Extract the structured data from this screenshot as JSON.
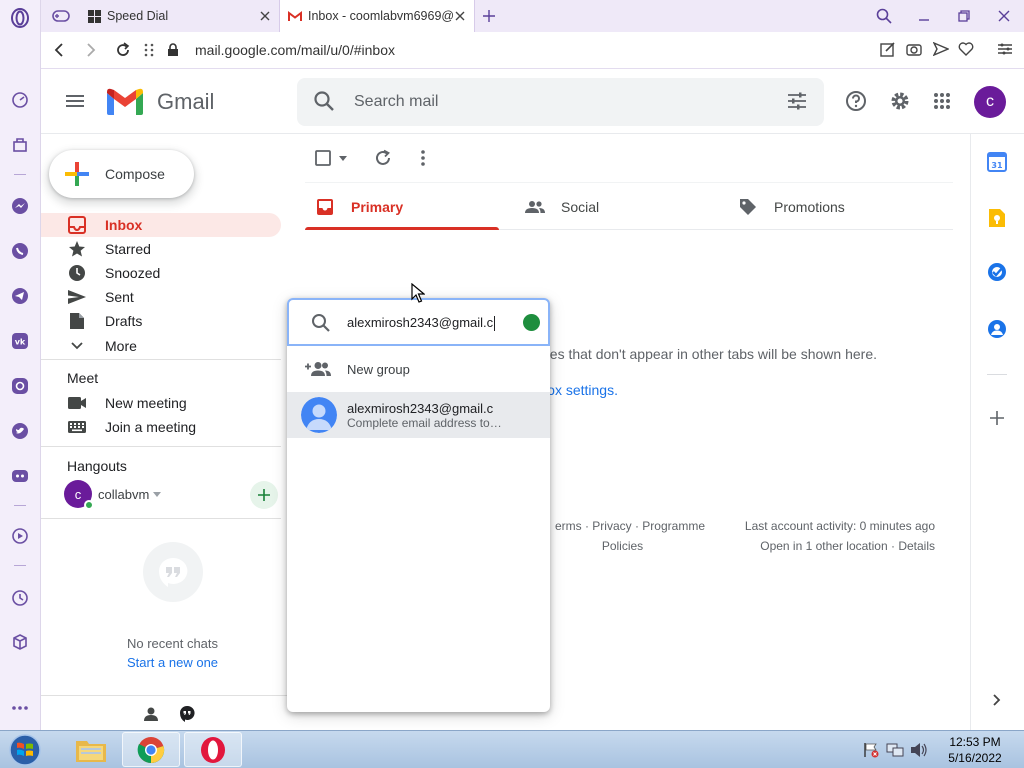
{
  "browser": {
    "tabs": [
      {
        "title": "Speed Dial",
        "active": false
      },
      {
        "title": "Inbox - coomlabvm6969@",
        "active": true
      }
    ],
    "url": "mail.google.com/mail/u/0/#inbox"
  },
  "gmail": {
    "wordmark": "Gmail",
    "search_placeholder": "Search mail",
    "avatar_letter": "c",
    "compose_label": "Compose",
    "nav": [
      {
        "label": "Inbox",
        "icon": "inbox-icon",
        "active": true
      },
      {
        "label": "Starred",
        "icon": "star-icon"
      },
      {
        "label": "Snoozed",
        "icon": "clock-icon"
      },
      {
        "label": "Sent",
        "icon": "send-icon"
      },
      {
        "label": "Drafts",
        "icon": "draft-icon"
      },
      {
        "label": "More",
        "icon": "chevron-down-icon"
      }
    ],
    "meet": {
      "title": "Meet",
      "items": [
        {
          "label": "New meeting",
          "icon": "video-icon"
        },
        {
          "label": "Join a meeting",
          "icon": "keyboard-icon"
        }
      ]
    },
    "hangouts": {
      "title": "Hangouts",
      "user_initial": "c",
      "user_name": "collabvm",
      "no_recent": "No recent chats",
      "start_new": "Start a new one"
    },
    "tabs": [
      {
        "label": "Primary",
        "icon": "inbox-icon",
        "active": true
      },
      {
        "label": "Social",
        "icon": "people-icon"
      },
      {
        "label": "Promotions",
        "icon": "tag-icon"
      }
    ],
    "empty_message": "es that don't appear in other tabs will be shown here.",
    "inbox_settings_link": "ox settings.",
    "footer": {
      "terms_line1": "erms · Privacy · Programme",
      "terms_line2": "Policies",
      "activity": "Last account activity: 0 minutes ago",
      "other_location": "Open in 1 other location · Details"
    }
  },
  "popup": {
    "input_value": "alexmirosh2343@gmail.c",
    "new_group_label": "New group",
    "suggestion_name": "alexmirosh2343@gmail.c",
    "suggestion_sub": "Complete email address to…"
  },
  "taskbar": {
    "time": "12:53 PM",
    "date": "5/16/2022"
  },
  "colors": {
    "gmail_red": "#d93025",
    "opera_purple": "#6a4fa3",
    "avatar_purple": "#6a1b9a",
    "link_blue": "#1a73e8",
    "status_green": "#1e8e3e"
  }
}
